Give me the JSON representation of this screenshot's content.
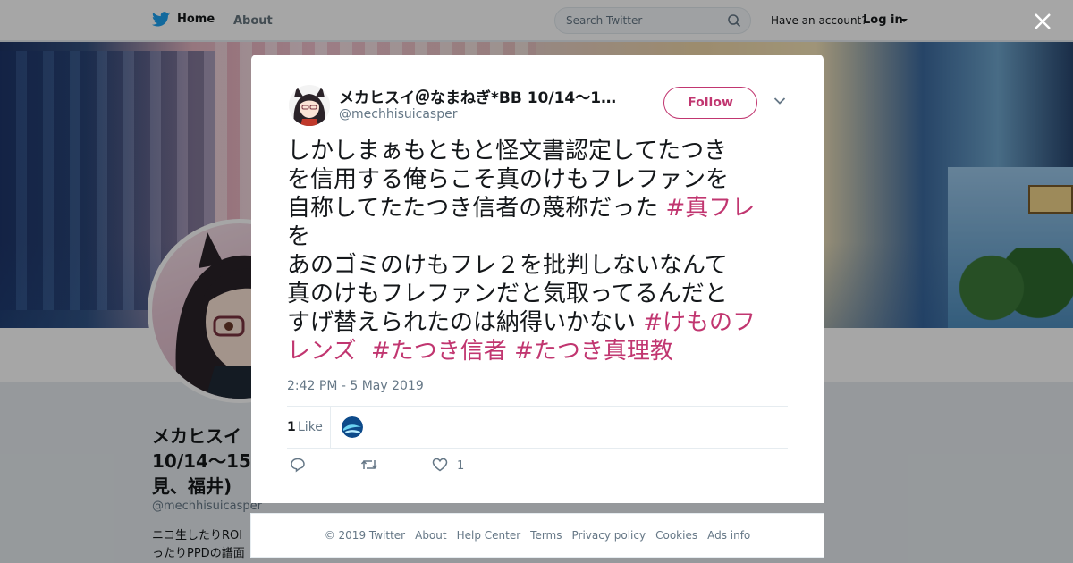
{
  "nav": {
    "home_label": "Home",
    "about_label": "About",
    "search_placeholder": "Search Twitter",
    "have_account": "Have an account?",
    "login_label": "Log in"
  },
  "profile": {
    "name_lines": [
      "メカヒスイ",
      "10/14～15:□",
      "見、福井)"
    ],
    "handle": "@mechhisuicasper",
    "bio_lines": [
      "ニコ生したりROI",
      "ったりPPDの譜面"
    ]
  },
  "tweet": {
    "author_name": "メカヒスイ＠なまねぎ*BB 10/14～1…",
    "author_handle": "@mechhisuicasper",
    "follow_label": "Follow",
    "text_segments": [
      {
        "t": "しかしまぁもともと怪文書認定してたつき\nを信用する俺らこそ真のけもフレファンを\n自称してたたつき信者の蔑称だった ",
        "h": false
      },
      {
        "t": "#真フレ",
        "h": true
      },
      {
        "t": "\nを\nあのゴミのけもフレ２を批判しないなんて\n真のけもフレファンだと気取ってるんだと\nすげ替えられたのは納得いかない ",
        "h": false
      },
      {
        "t": "#けものフ\nレンズ",
        "h": true
      },
      {
        "t": "  ",
        "h": false
      },
      {
        "t": "#たつき信者",
        "h": true
      },
      {
        "t": " ",
        "h": false
      },
      {
        "t": "#たつき真理教",
        "h": true
      }
    ],
    "timestamp": "2:42 PM - 5 May 2019",
    "likes_count": "1",
    "likes_label": "Like",
    "action_like_count": "1"
  },
  "footer": {
    "copyright": "© 2019 Twitter",
    "links": [
      "About",
      "Help Center",
      "Terms",
      "Privacy policy",
      "Cookies",
      "Ads info"
    ]
  },
  "colors": {
    "accent": "#c13670",
    "twitter_blue": "#1da1f2",
    "text": "#14171a",
    "muted": "#657786"
  },
  "icons": {
    "logo": "twitter-bird-icon",
    "search": "search-icon",
    "close": "close-icon",
    "caret": "chevron-down-icon",
    "reply": "reply-icon",
    "retweet": "retweet-icon",
    "like": "heart-icon"
  }
}
